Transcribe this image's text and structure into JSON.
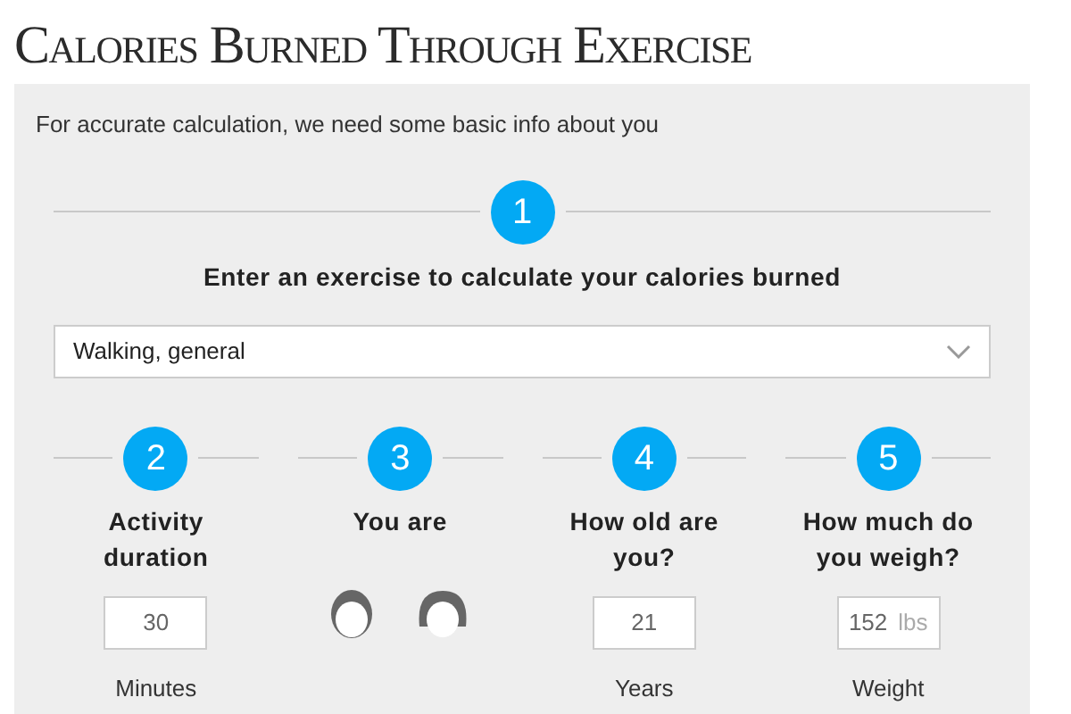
{
  "title": "Calories Burned Through Exercise",
  "intro": "For accurate calculation, we need some basic info about you",
  "step1": {
    "number": "1",
    "heading": "Enter an exercise to calculate your calories burned",
    "exercise": "Walking, general"
  },
  "steps": [
    {
      "kind": "input",
      "number": "2",
      "label": "Activity duration",
      "value": "30",
      "caption": "Minutes"
    },
    {
      "kind": "gender",
      "number": "3",
      "label": "You are"
    },
    {
      "kind": "input",
      "number": "4",
      "label": "How old are you?",
      "value": "21",
      "caption": "Years"
    },
    {
      "kind": "input",
      "number": "5",
      "label": "How much do you weigh?",
      "value": "152",
      "unit": "lbs",
      "caption": "Weight"
    }
  ]
}
